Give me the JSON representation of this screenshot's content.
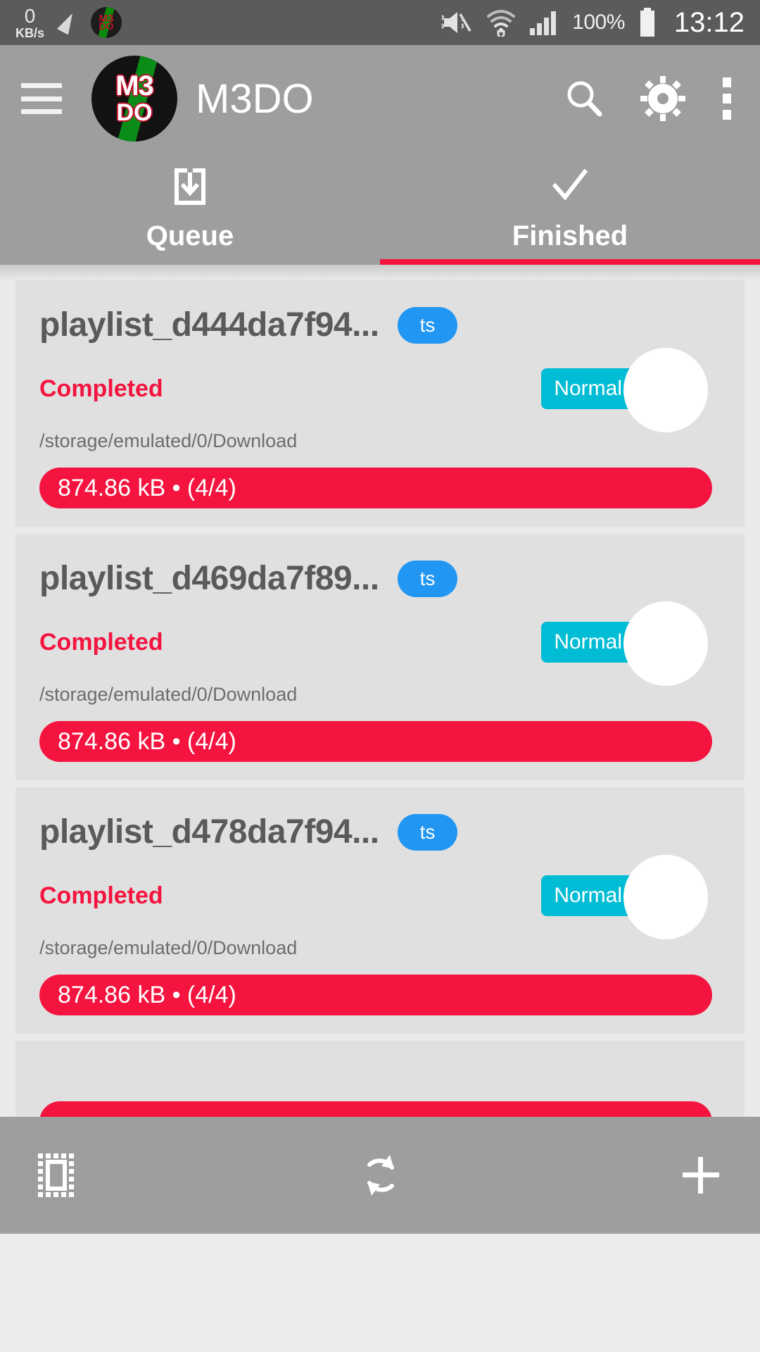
{
  "status_bar": {
    "net_speed_value": "0",
    "net_speed_unit": "KB/s",
    "pencil_icon": "pencil-icon",
    "app_notification_icon": "m3do-app-icon",
    "mute_icon": "volume-muted-icon",
    "wifi_icon": "wifi-icon",
    "signal_icon": "cellular-signal-icon",
    "battery_percent": "100%",
    "battery_icon": "battery-full-icon",
    "clock": "13:12"
  },
  "app_bar": {
    "menu_icon": "hamburger-menu-icon",
    "logo_line1": "M3",
    "logo_line2": "DO",
    "title": "M3DO",
    "search_icon": "search-icon",
    "settings_icon": "gear-icon",
    "overflow_icon": "more-vertical-icon"
  },
  "tabs": {
    "active_index": 1,
    "accent_color": "#f4143f",
    "items": [
      {
        "label": "Queue",
        "icon": "download-box-icon"
      },
      {
        "label": "Finished",
        "icon": "check-icon"
      }
    ]
  },
  "downloads": {
    "items": [
      {
        "title": "playlist_d444da7f94...",
        "extension": "ts",
        "status": "Completed",
        "priority": "Normal",
        "path": "/storage/emulated/0/Download",
        "progress_text": "874.86 kB • (4/4)",
        "progress_percent": 100,
        "play_icon": "play-icon"
      },
      {
        "title": "playlist_d469da7f89...",
        "extension": "ts",
        "status": "Completed",
        "priority": "Normal",
        "path": "/storage/emulated/0/Download",
        "progress_text": "874.86 kB • (4/4)",
        "progress_percent": 100,
        "play_icon": "play-icon"
      },
      {
        "title": "playlist_d478da7f94...",
        "extension": "ts",
        "status": "Completed",
        "priority": "Normal",
        "path": "/storage/emulated/0/Download",
        "progress_text": "874.86 kB • (4/4)",
        "progress_percent": 100,
        "play_icon": "play-icon"
      }
    ],
    "extension_badge_color": "#2196f3",
    "priority_badge_color": "#00bcd4",
    "status_color": "#f4143f",
    "progress_color": "#f4143f"
  },
  "bottom_bar": {
    "select_all_icon": "select-all-icon",
    "refresh_icon": "refresh-icon",
    "add_icon": "plus-icon"
  }
}
